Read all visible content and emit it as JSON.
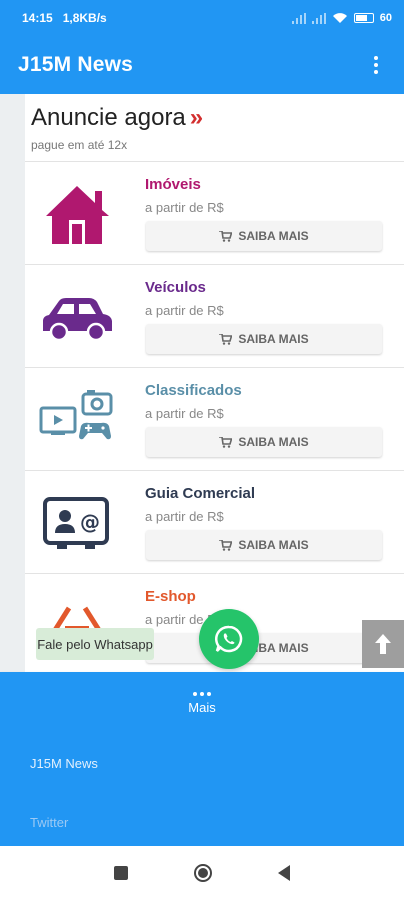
{
  "status": {
    "time": "14:15",
    "speed": "1,8KB/s",
    "battery": "60"
  },
  "appbar": {
    "title": "J15M News"
  },
  "headline": {
    "title": "Anuncie agora",
    "arrow": "»",
    "subtitle": "pague em até 12x"
  },
  "items": [
    {
      "name": "Imóveis",
      "price": "a partir de R$",
      "button": "SAIBA MAIS",
      "color": "#b0186f",
      "icon": "house-icon"
    },
    {
      "name": "Veículos",
      "price": "a partir de R$",
      "button": "SAIBA MAIS",
      "color": "#6a2a8c",
      "icon": "car-icon"
    },
    {
      "name": "Classificados",
      "price": "a partir de R$",
      "button": "SAIBA MAIS",
      "color": "#5a8fa8",
      "icon": "classifieds-icon"
    },
    {
      "name": "Guia Comercial",
      "price": "a partir de R$",
      "button": "SAIBA MAIS",
      "color": "#2f3b52",
      "icon": "business-card-icon"
    },
    {
      "name": "E-shop",
      "price": "a partir de R$",
      "button": "SAIBA MAIS",
      "color": "#e2582c",
      "icon": "eshop-icon"
    }
  ],
  "whatsapp": {
    "label": "Fale pelo Whatsapp"
  },
  "bottomnav": {
    "label": "Mais"
  },
  "footer": {
    "link1": "J15M News",
    "link2": "Twitter"
  }
}
